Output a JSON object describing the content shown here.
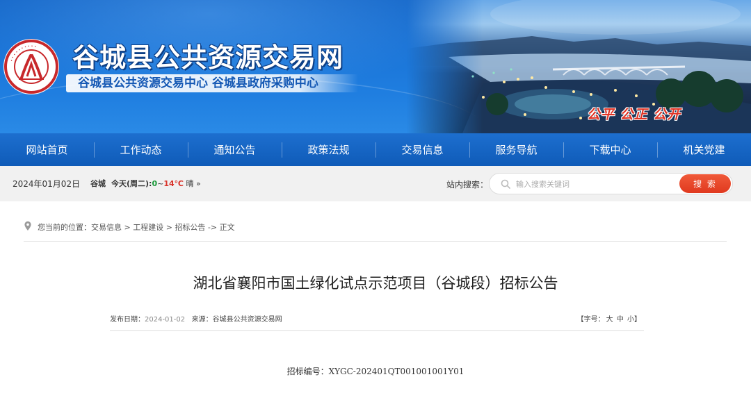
{
  "header": {
    "site_title": "谷城县公共资源交易网",
    "subtitle": "谷城县公共资源交易中心  谷城县政府采购中心",
    "slogan": "公平  公正  公开",
    "emblem_text": "谷城县公共资源交易中心"
  },
  "nav": {
    "items": [
      {
        "label": "网站首页"
      },
      {
        "label": "工作动态"
      },
      {
        "label": "通知公告"
      },
      {
        "label": "政策法规"
      },
      {
        "label": "交易信息"
      },
      {
        "label": "服务导航"
      },
      {
        "label": "下载中心"
      },
      {
        "label": "机关党建"
      }
    ]
  },
  "infobar": {
    "date": "2024年01月02日",
    "weather": {
      "location": "谷城",
      "day": "今天(周二):",
      "temp_low": "0",
      "sep": "~",
      "temp_high": "14℃",
      "condition": "晴",
      "more": "»"
    },
    "search_label": "站内搜索：",
    "search_placeholder": "输入搜索关键词",
    "search_button": "搜 索"
  },
  "breadcrumb": {
    "prefix": "您当前的位置：",
    "items": [
      "交易信息",
      "工程建设",
      "招标公告"
    ],
    "sep": " > ",
    "last_sep": " -> ",
    "current": "正文"
  },
  "article": {
    "title": "湖北省襄阳市国土绿化试点示范项目（谷城段）招标公告",
    "publish_label": "发布日期：",
    "publish_date": "2024-01-02",
    "source_label": "来源：",
    "source": "谷城县公共资源交易网",
    "font_label": "【字号：",
    "font_large": "大",
    "font_medium": "中",
    "font_small": "小",
    "font_close": "】",
    "bid_number_label": "招标编号：",
    "bid_number": "XYGC-202401QT001001001Y01"
  },
  "colors": {
    "brand_blue": "#1567c9",
    "nav_blue": "#0f5bb8",
    "search_red": "#e0391f",
    "slogan_red": "#e03324",
    "temp_low_green": "#1a9a3a",
    "temp_high_red": "#d9342b"
  }
}
